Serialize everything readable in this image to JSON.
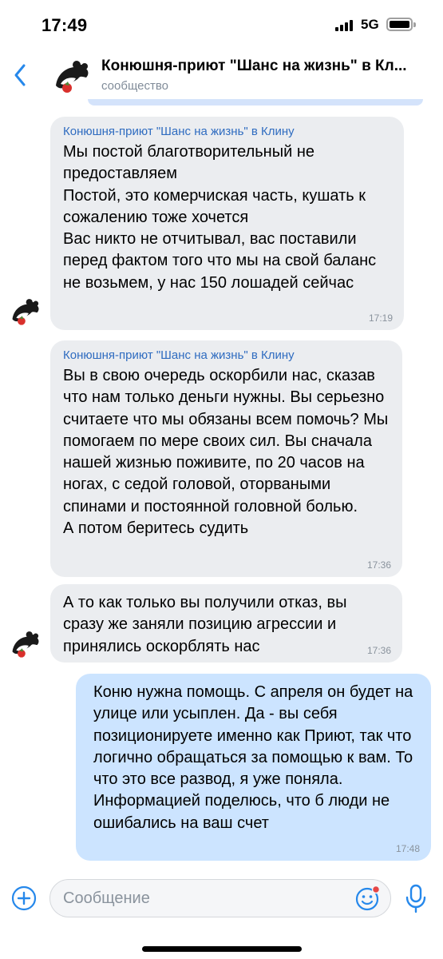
{
  "status_bar": {
    "time": "17:49",
    "network": "5G"
  },
  "header": {
    "title": "Конюшня-приют \"Шанс на жизнь\" в Кл...",
    "subtitle": "сообщество"
  },
  "messages": [
    {
      "direction": "in",
      "sender": "Конюшня-приют \"Шанс на жизнь\" в Клину",
      "text": "Мы постой благотворительный не предоставляем\nПостой, это комерчиская часть, кушать к сожалению тоже хочется\nВас никто не отчитывал, вас поставили перед фактом того что мы на свой баланс не возьмем, у нас 150 лошадей сейчас",
      "time": "17:19"
    },
    {
      "direction": "in",
      "sender": "Конюшня-приют \"Шанс на жизнь\" в Клину",
      "text": "Вы в свою очередь оскорбили нас, сказав что нам только деньги нужны. Вы серьезно считаете что мы обязаны всем помочь? Мы помогаем по мере своих сил. Вы сначала нашей жизнью поживите, по 20 часов на ногах, с седой головой, оторваными спинами и постоянной головной болью.\nА потом беритесь судить",
      "time": "17:36"
    },
    {
      "direction": "in",
      "sender": "",
      "text": "А то как только вы получили отказ, вы сразу же заняли позицию агрессии и принялись оскорблять нас",
      "time": "17:36"
    },
    {
      "direction": "out",
      "sender": "",
      "text": "Коню нужна помощь. С апреля он будет на улице или усыплен. Да - вы себя позиционируете именно как Приют, так что логично обращаться за помощью к вам. То что это все развод, я уже поняла. Информацией поделюсь, что б люди не ошибались на ваш счет",
      "time": "17:48"
    }
  ],
  "composer": {
    "placeholder": "Сообщение"
  },
  "icons": {
    "back": "chevron-left-icon",
    "attach": "plus-circle-icon",
    "emoji": "smiley-icon",
    "voice": "microphone-icon"
  },
  "colors": {
    "accent": "#2f6cc0",
    "incoming_bubble": "#ebedf0",
    "outgoing_bubble": "#cce4ff"
  }
}
